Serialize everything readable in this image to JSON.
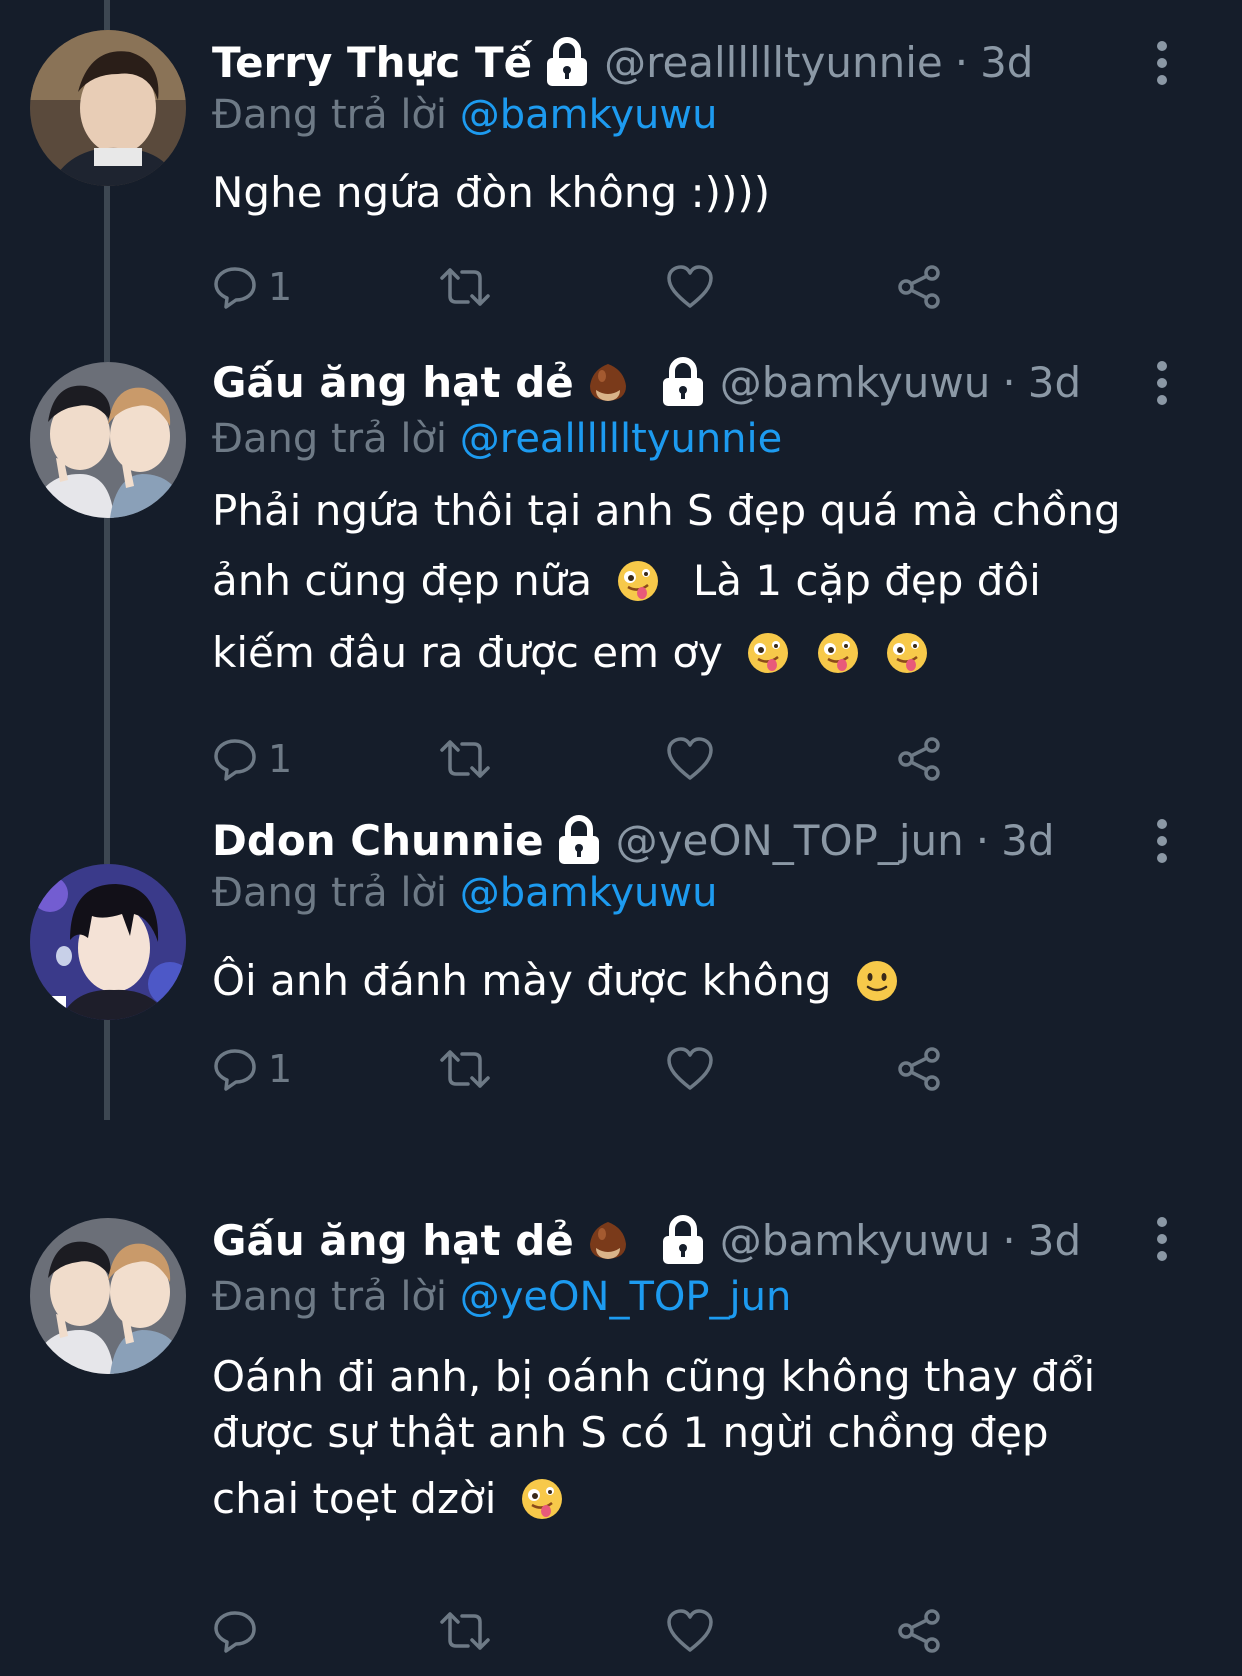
{
  "tweets": [
    {
      "display_name": "Terry Thực Tế",
      "handle": "@realllllltyunnie",
      "separator": "·",
      "time": "3d",
      "reply_prefix": "Đang trả lời",
      "reply_to": "@bamkyuwu",
      "text_lines": [
        "Nghe ngứa đòn không :))))"
      ],
      "reply_count": "1",
      "has_chestnut": false
    },
    {
      "display_name": "Gấu ăng hạt dẻ",
      "handle": "@bamkyuwu",
      "separator": "·",
      "time": "3d",
      "reply_prefix": "Đang trả lời",
      "reply_to": "@realllllltyunnie",
      "text_lines": [
        "Phải ngứa thôi tại anh S đẹp quá mà chồng",
        "ảnh cũng đẹp nữa",
        "Là 1 cặp đẹp đôi",
        "kiếm đâu ra được em ơy"
      ],
      "reply_count": "1",
      "has_chestnut": true
    },
    {
      "display_name": "Ddon Chunnie",
      "handle": "@yeON_TOP_jun",
      "separator": "·",
      "time": "3d",
      "reply_prefix": "Đang trả lời",
      "reply_to": "@bamkyuwu",
      "text_lines": [
        "Ôi anh đánh mày được không"
      ],
      "reply_count": "1",
      "has_chestnut": false
    },
    {
      "display_name": "Gấu ăng hạt dẻ",
      "handle": "@bamkyuwu",
      "separator": "·",
      "time": "3d",
      "reply_prefix": "Đang trả lời",
      "reply_to": "@yeON_TOP_jun",
      "text_lines": [
        "Oánh đi anh, bị oánh cũng không thay đổi",
        "được sự thật anh S có 1 ngừi chồng đẹp",
        "chai toẹt dzời"
      ],
      "reply_count": "",
      "has_chestnut": true
    }
  ],
  "icons": {
    "reply": "speech-bubble",
    "retweet": "retweet-arrows",
    "like": "heart",
    "share": "share-nodes",
    "lock": "padlock",
    "more": "vertical-dots"
  },
  "colors": {
    "background": "#151d2a",
    "mention": "#1d9bf0",
    "muted": "#8b98a5",
    "thread_line": "#3d4752"
  }
}
